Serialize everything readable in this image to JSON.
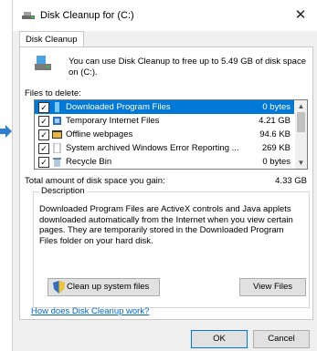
{
  "window": {
    "title": "Disk Cleanup for  (C:)",
    "close_glyph": "✕"
  },
  "tab": {
    "label": "Disk Cleanup"
  },
  "intro": {
    "text": "You can use Disk Cleanup to free up to 5.49 GB of disk space on  (C:)."
  },
  "files": {
    "label": "Files to delete:",
    "items": [
      {
        "name": "Downloaded Program Files",
        "size": "0 bytes",
        "checked": true,
        "selected": true,
        "icon": "folder-icon"
      },
      {
        "name": "Temporary Internet Files",
        "size": "4.21 GB",
        "checked": true,
        "selected": false,
        "icon": "internet-files-icon"
      },
      {
        "name": "Offline webpages",
        "size": "94.6 KB",
        "checked": true,
        "selected": false,
        "icon": "offline-page-icon"
      },
      {
        "name": "System archived Windows Error Reporting ...",
        "size": "269 KB",
        "checked": true,
        "selected": false,
        "icon": "document-icon"
      },
      {
        "name": "Recycle Bin",
        "size": "0 bytes",
        "checked": true,
        "selected": false,
        "icon": "recycle-bin-icon"
      }
    ]
  },
  "gain": {
    "label": "Total amount of disk space you gain:",
    "value": "4.33 GB"
  },
  "description": {
    "legend": "Description",
    "text": "Downloaded Program Files are ActiveX controls and Java applets downloaded automatically from the Internet when you view certain pages. They are temporarily stored in the Downloaded Program Files folder on your hard disk."
  },
  "buttons": {
    "cleanup": "Clean up system files",
    "view": "View Files",
    "ok": "OK",
    "cancel": "Cancel"
  },
  "help_link": "How does Disk Cleanup work?",
  "colors": {
    "accent": "#0078d7",
    "link": "#0066cc",
    "pointer": "#2b7fd0"
  }
}
